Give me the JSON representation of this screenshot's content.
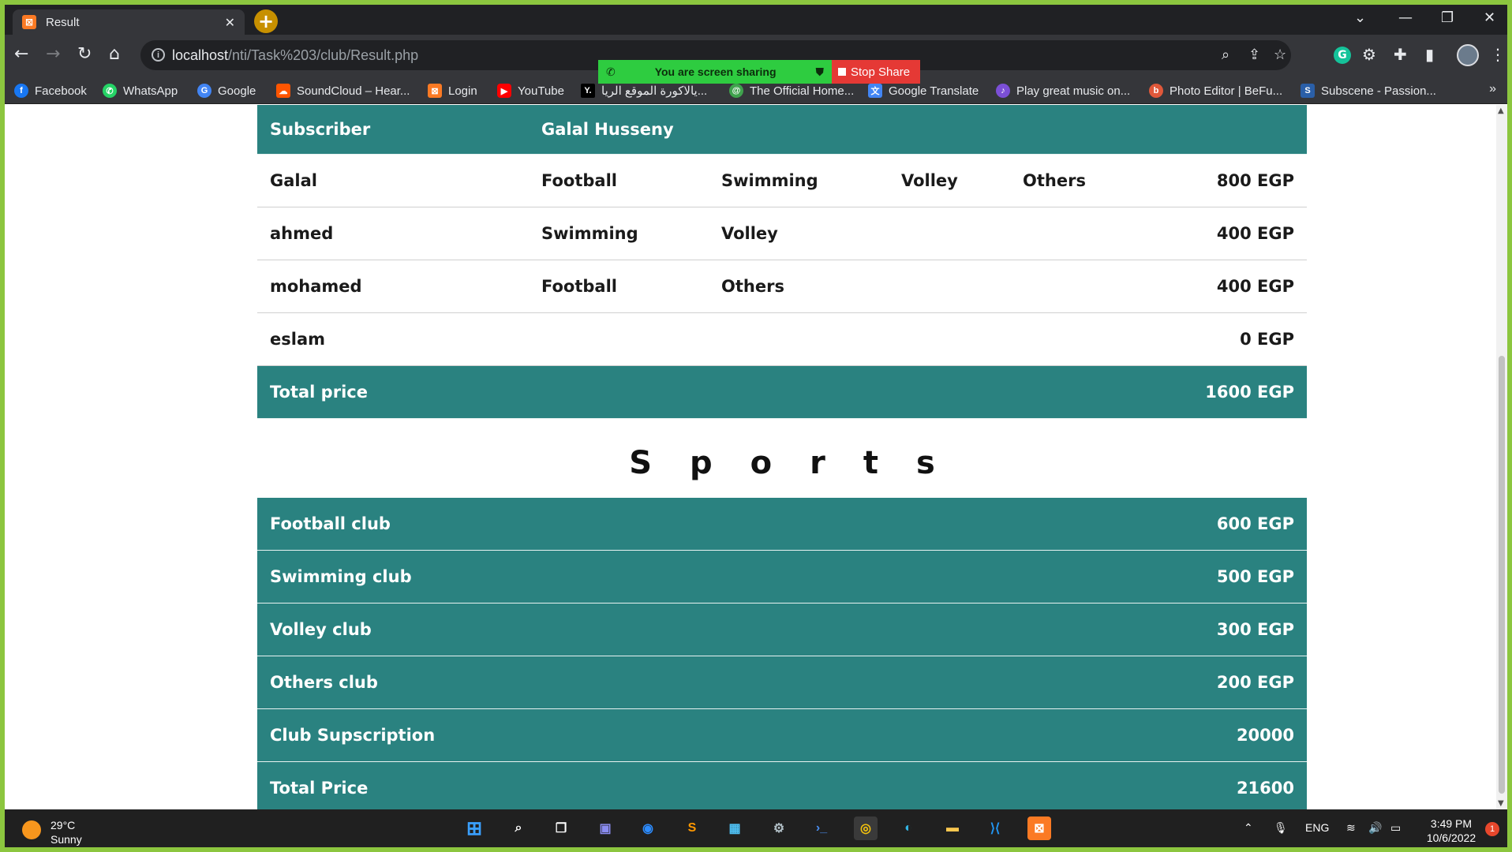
{
  "browser": {
    "tab_title": "Result",
    "url_host": "localhost",
    "url_path": "/nti/Task%203/club/Result.php"
  },
  "bookmarks": [
    {
      "label": "Facebook",
      "icon": "facebook-icon",
      "color": "#1877f2"
    },
    {
      "label": "WhatsApp",
      "icon": "whatsapp-icon",
      "color": "#25d366"
    },
    {
      "label": "Google",
      "icon": "google-icon",
      "color": "#4285f4"
    },
    {
      "label": "SoundCloud – Hear...",
      "icon": "soundcloud-icon",
      "color": "#ff5500"
    },
    {
      "label": "Login",
      "icon": "xampp-icon",
      "color": "#fb7a24"
    },
    {
      "label": "YouTube",
      "icon": "youtube-icon",
      "color": "#ff0000"
    },
    {
      "label": "يالاكورة الموقع الريا...",
      "icon": "yallakora-icon",
      "color": "#000000"
    },
    {
      "label": "The Official Home...",
      "icon": "official-home-icon",
      "color": "#3fa34d"
    },
    {
      "label": "Google Translate",
      "icon": "translate-icon",
      "color": "#4285f4"
    },
    {
      "label": "Play great music on...",
      "icon": "music-icon",
      "color": "#7b4fd6"
    },
    {
      "label": "Photo Editor | BeFu...",
      "icon": "photo-editor-icon",
      "color": "#e0583a"
    },
    {
      "label": "Subscene - Passion...",
      "icon": "subscene-icon",
      "color": "#2a5fa8"
    }
  ],
  "share_banner": {
    "message": "You are screen sharing",
    "stop_label": "Stop Share"
  },
  "subscriber_table": {
    "header": {
      "label": "Subscriber",
      "name": "Galal Husseny"
    },
    "rows": [
      {
        "name": "Galal",
        "s1": "Football",
        "s2": "Swimming",
        "s3": "Volley",
        "s4": "Others",
        "price": "800 EGP"
      },
      {
        "name": "ahmed",
        "s1": "Swimming",
        "s2": "Volley",
        "s3": "",
        "s4": "",
        "price": "400 EGP"
      },
      {
        "name": "mohamed",
        "s1": "Football",
        "s2": "Others",
        "s3": "",
        "s4": "",
        "price": "400 EGP"
      },
      {
        "name": "eslam",
        "s1": "",
        "s2": "",
        "s3": "",
        "s4": "",
        "price": "0 EGP"
      }
    ],
    "total": {
      "label": "Total price",
      "value": "1600 EGP"
    }
  },
  "sports": {
    "heading": "Sports",
    "rows": [
      {
        "label": "Football club",
        "value": "600 EGP"
      },
      {
        "label": "Swimming club",
        "value": "500 EGP"
      },
      {
        "label": "Volley club",
        "value": "300 EGP"
      },
      {
        "label": "Others club",
        "value": "200 EGP"
      },
      {
        "label": "Club Supscription",
        "value": "20000"
      },
      {
        "label": "Total Price",
        "value": "21600"
      }
    ]
  },
  "taskbar": {
    "temperature": "29°C",
    "condition": "Sunny",
    "language": "ENG",
    "time": "3:49 PM",
    "date": "10/6/2022",
    "notifications": "1"
  },
  "colors": {
    "teal": "#2a8280",
    "frame": "#8cc63f"
  }
}
